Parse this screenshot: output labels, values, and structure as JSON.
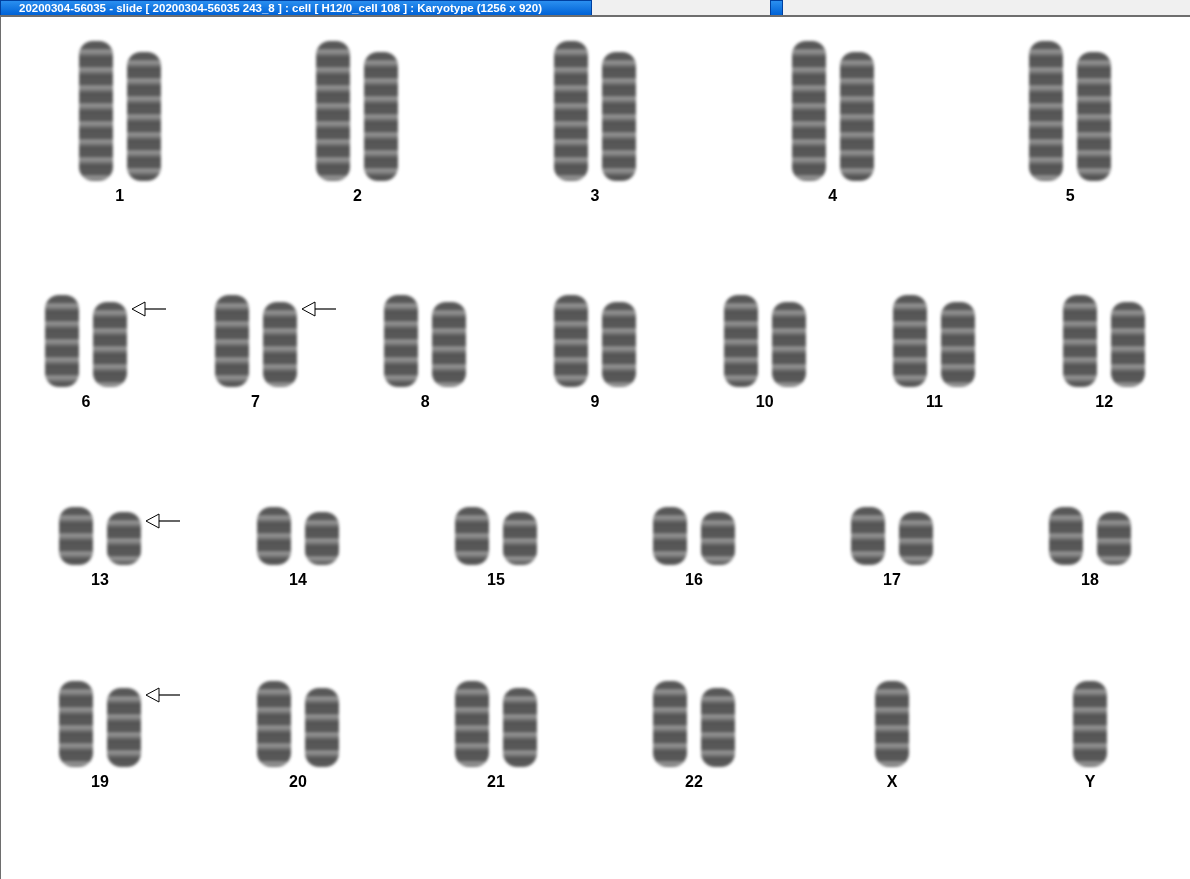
{
  "window": {
    "title": "20200304-56035 - slide [ 20200304-56035 243_8 ] : cell [ H12/0_cell 108 ] : Karyotype  (1256 x 920)"
  },
  "karyotype_rows": [
    {
      "groups": [
        {
          "label": "1",
          "kind": "pair",
          "arrow": false
        },
        {
          "label": "2",
          "kind": "pair",
          "arrow": false
        },
        {
          "label": "3",
          "kind": "pair",
          "arrow": false
        },
        {
          "label": "4",
          "kind": "pair",
          "arrow": false
        },
        {
          "label": "5",
          "kind": "pair",
          "arrow": false
        }
      ]
    },
    {
      "groups": [
        {
          "label": "6",
          "kind": "pair",
          "arrow": true
        },
        {
          "label": "7",
          "kind": "pair",
          "arrow": true
        },
        {
          "label": "8",
          "kind": "pair",
          "arrow": false
        },
        {
          "label": "9",
          "kind": "pair",
          "arrow": false
        },
        {
          "label": "10",
          "kind": "pair",
          "arrow": false
        },
        {
          "label": "11",
          "kind": "pair",
          "arrow": false
        },
        {
          "label": "12",
          "kind": "pair",
          "arrow": false
        }
      ]
    },
    {
      "groups": [
        {
          "label": "13",
          "kind": "pair",
          "arrow": true
        },
        {
          "label": "14",
          "kind": "pair",
          "arrow": false
        },
        {
          "label": "15",
          "kind": "pair",
          "arrow": false
        },
        {
          "label": "16",
          "kind": "pair",
          "arrow": false
        },
        {
          "label": "17",
          "kind": "pair",
          "arrow": false
        },
        {
          "label": "18",
          "kind": "pair",
          "arrow": false
        }
      ]
    },
    {
      "groups": [
        {
          "label": "19",
          "kind": "pair",
          "arrow": true
        },
        {
          "label": "20",
          "kind": "pair",
          "arrow": false
        },
        {
          "label": "21",
          "kind": "pair",
          "arrow": false
        },
        {
          "label": "22",
          "kind": "pair",
          "arrow": false
        },
        {
          "label": "X",
          "kind": "single",
          "arrow": false
        },
        {
          "label": "Y",
          "kind": "single",
          "arrow": false
        }
      ]
    }
  ]
}
